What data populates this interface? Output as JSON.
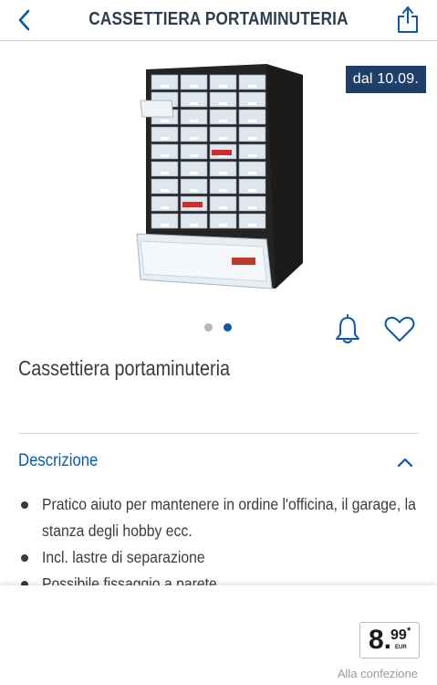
{
  "navbar": {
    "title": "CASSETTIERA PORTAMINUTERIA",
    "back_icon": "chevron-left-icon",
    "share_icon": "share-icon"
  },
  "product": {
    "image": "drawer-cabinet",
    "badge": "dal 10.09.",
    "title": "Cassettiera portaminuteria",
    "carousel": {
      "total": 2,
      "active": 2
    }
  },
  "actions": {
    "alert_icon": "bell-icon",
    "favorite_icon": "heart-icon"
  },
  "description": {
    "header": "Descrizione",
    "items": [
      "Pratico aiuto per mantenere in ordine l'officina, il garage, la stanza degli hobby ecc.",
      "Incl. lastre di separazione",
      "Possibile fissaggio a parete"
    ]
  },
  "price": {
    "integer": "8.",
    "decimals": "99",
    "asterisk": "*",
    "currency": "EUR",
    "unit_label": "Alla confezione"
  },
  "colors": {
    "brand_blue": "#0a5aa8",
    "badge_bg": "#1f3f6b",
    "title_dark": "#2b3e50"
  }
}
